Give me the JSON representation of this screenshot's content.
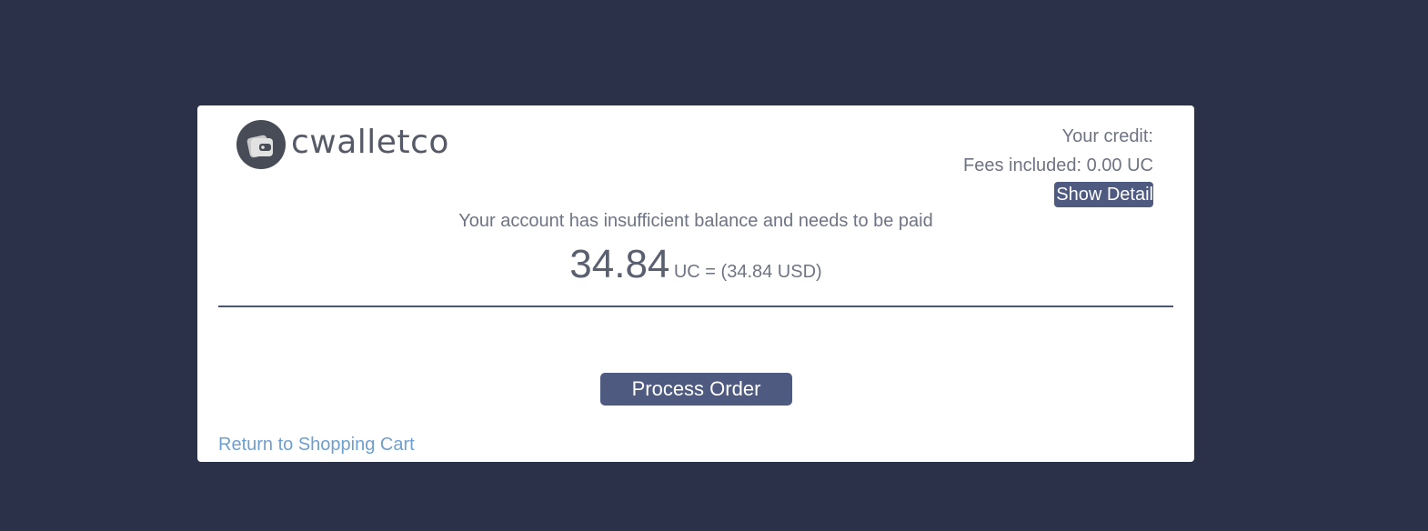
{
  "brand": {
    "name": "cwalletco",
    "icon": "wallet-icon"
  },
  "credit": {
    "label": "Your credit:",
    "fees_line": "Fees included: 0.00 UC",
    "show_detail_label": "Show Detail"
  },
  "payment": {
    "message": "Your account has insufficient balance and needs to be paid",
    "amount": "34.84",
    "conversion": "UC = (34.84 USD)"
  },
  "actions": {
    "process_order_label": "Process Order",
    "return_link_label": "Return to Shopping Cart"
  },
  "colors": {
    "page_background": "#2a3149",
    "card_background": "#ffffff",
    "accent_button": "#4e5a80",
    "link": "#6f9fcf"
  }
}
